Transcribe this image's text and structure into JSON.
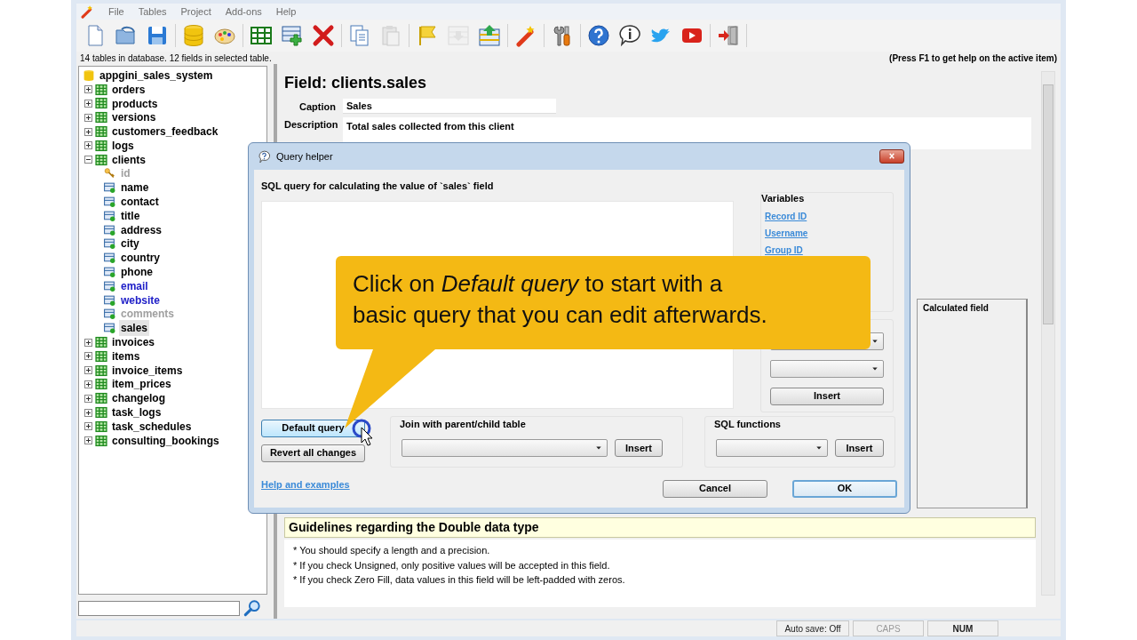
{
  "menu": [
    {
      "label": "File"
    },
    {
      "label": "Tables"
    },
    {
      "label": "Project"
    },
    {
      "label": "Add-ons"
    },
    {
      "label": "Help"
    }
  ],
  "toolbar": [
    [
      {
        "kind": "new-file",
        "disabled": false
      },
      {
        "kind": "open-folder",
        "disabled": false
      },
      {
        "kind": "save",
        "disabled": false
      }
    ],
    [
      {
        "kind": "database",
        "disabled": false
      },
      {
        "kind": "palette",
        "disabled": false
      }
    ],
    [
      {
        "kind": "table",
        "disabled": false
      },
      {
        "kind": "add-table",
        "disabled": false
      },
      {
        "kind": "delete",
        "disabled": false
      }
    ],
    [
      {
        "kind": "copy",
        "disabled": false
      },
      {
        "kind": "paste",
        "disabled": true
      }
    ],
    [
      {
        "kind": "flag",
        "disabled": false
      },
      {
        "kind": "import",
        "disabled": true
      },
      {
        "kind": "export",
        "disabled": false
      }
    ],
    [
      {
        "kind": "wand",
        "disabled": false
      }
    ],
    [
      {
        "kind": "tools",
        "disabled": false
      }
    ],
    [
      {
        "kind": "help",
        "disabled": false
      },
      {
        "kind": "info",
        "disabled": false
      },
      {
        "kind": "bird",
        "disabled": false
      },
      {
        "kind": "video",
        "disabled": false
      }
    ],
    [
      {
        "kind": "exit",
        "disabled": false
      }
    ]
  ],
  "info_line": "14 tables in database. 12 fields in selected table.",
  "help_hint": "(Press F1 to get help on the active item)",
  "tree": {
    "label": "appgini_sales_system",
    "children": [
      {
        "label": "orders",
        "expanded": false
      },
      {
        "label": "products",
        "expanded": false
      },
      {
        "label": "versions",
        "expanded": false
      },
      {
        "label": "customers_feedback",
        "expanded": false
      },
      {
        "label": "logs",
        "expanded": false
      },
      {
        "label": "clients",
        "expanded": true,
        "children": [
          {
            "label": "id",
            "kind": "key",
            "color": "#a0a0a0",
            "selected": false
          },
          {
            "label": "name",
            "kind": "field",
            "color": "#000000",
            "selected": false
          },
          {
            "label": "contact",
            "kind": "field",
            "color": "#000000",
            "selected": false
          },
          {
            "label": "title",
            "kind": "field",
            "color": "#000000",
            "selected": false
          },
          {
            "label": "address",
            "kind": "field",
            "color": "#000000",
            "selected": false
          },
          {
            "label": "city",
            "kind": "field",
            "color": "#000000",
            "selected": false
          },
          {
            "label": "country",
            "kind": "field",
            "color": "#000000",
            "selected": false
          },
          {
            "label": "phone",
            "kind": "field",
            "color": "#000000",
            "selected": false
          },
          {
            "label": "email",
            "kind": "field",
            "color": "#2020c8",
            "selected": false
          },
          {
            "label": "website",
            "kind": "field",
            "color": "#2020c8",
            "selected": false
          },
          {
            "label": "comments",
            "kind": "field",
            "color": "#a0a0a0",
            "selected": false
          },
          {
            "label": "sales",
            "kind": "field",
            "color": "#000000",
            "selected": true
          }
        ]
      },
      {
        "label": "invoices",
        "expanded": false
      },
      {
        "label": "items",
        "expanded": false
      },
      {
        "label": "invoice_items",
        "expanded": false
      },
      {
        "label": "item_prices",
        "expanded": false
      },
      {
        "label": "changelog",
        "expanded": false
      },
      {
        "label": "task_logs",
        "expanded": false
      },
      {
        "label": "task_schedules",
        "expanded": false
      },
      {
        "label": "consulting_bookings",
        "expanded": false
      }
    ]
  },
  "field": {
    "title": "Field: clients.sales",
    "caption_label": "Caption",
    "caption": "Sales",
    "description_label": "Description",
    "description": "Total sales collected from this client",
    "tab": "Calculated field"
  },
  "guidelines": {
    "heading": "Guidelines regarding the Double data type",
    "lines": [
      "* You should specify a length and a precision.",
      "* If you check Unsigned, only positive values will be accepted in this field.",
      "* If you check Zero Fill, data values in this field will be left-padded with zeros."
    ]
  },
  "status_bar": [
    {
      "label": "Auto save: Off",
      "on": true
    },
    {
      "label": "CAPS",
      "on": false
    },
    {
      "label": "NUM",
      "on": true
    }
  ],
  "dialog": {
    "title": "Query helper",
    "sql_label": "SQL query for calculating the value of `sales` field",
    "variables_heading": "Variables",
    "variables": [
      "Record ID",
      "Username",
      "Group ID"
    ],
    "fields_insert": "Insert",
    "default_button": {
      "label": "Default query",
      "hover": true
    },
    "revert_button": "Revert all changes",
    "join_heading": "Join with parent/child table",
    "join_insert": "Insert",
    "functions_heading": "SQL functions",
    "functions_insert": "Insert",
    "help_link": "Help and examples",
    "cancel": "Cancel",
    "ok": {
      "label": "OK",
      "default": true
    }
  },
  "callout": [
    "Click on *Default query* to start with a",
    "basic query that you can edit afterwards."
  ]
}
